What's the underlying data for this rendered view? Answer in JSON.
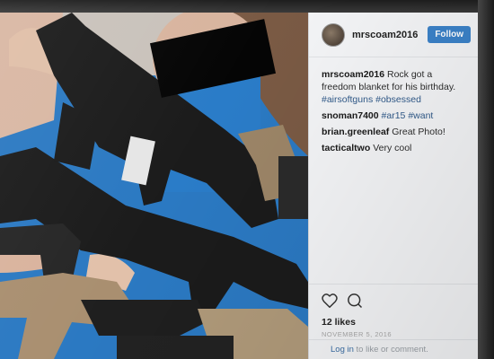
{
  "post": {
    "photo_description_icon": "photo-icon"
  },
  "header": {
    "username": "mrscoam2016",
    "follow_label": "Follow"
  },
  "comments": [
    {
      "user": "mrscoam2016",
      "text": "Rock got a freedom blanket for his birthday.",
      "tags": "#airsoftguns #obsessed"
    },
    {
      "user": "snoman7400",
      "text": "",
      "tags": "#ar15 #want"
    },
    {
      "user": "brian.greenleaf",
      "text": "Great Photo!",
      "tags": ""
    },
    {
      "user": "tacticaltwo",
      "text": "Very cool",
      "tags": ""
    }
  ],
  "footer": {
    "likes": "12 likes",
    "date": "NOVEMBER 5, 2016",
    "login_link": "Log in",
    "login_rest": " to like or comment."
  },
  "colors": {
    "follow_button": "#3b82c9",
    "panel_bg": "#f4f5f7",
    "blanket_blue": "#1f6fb5"
  }
}
